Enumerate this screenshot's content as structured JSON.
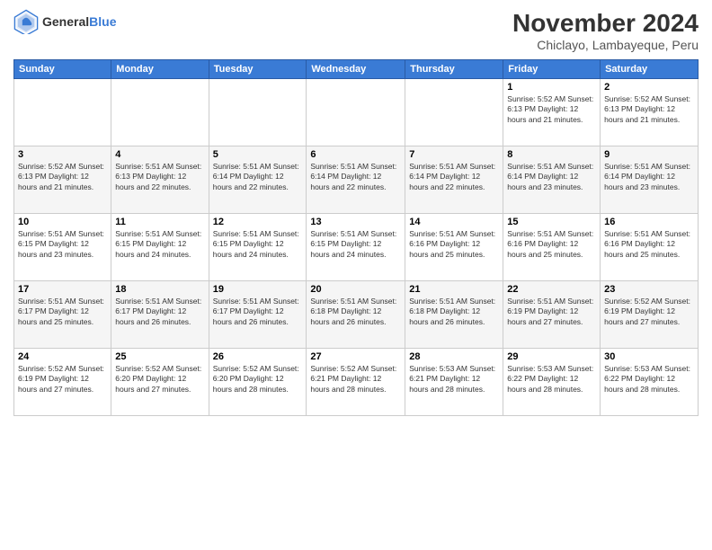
{
  "header": {
    "logo_line1": "General",
    "logo_line2": "Blue",
    "month": "November 2024",
    "location": "Chiclayo, Lambayeque, Peru"
  },
  "weekdays": [
    "Sunday",
    "Monday",
    "Tuesday",
    "Wednesday",
    "Thursday",
    "Friday",
    "Saturday"
  ],
  "weeks": [
    [
      {
        "day": "",
        "info": ""
      },
      {
        "day": "",
        "info": ""
      },
      {
        "day": "",
        "info": ""
      },
      {
        "day": "",
        "info": ""
      },
      {
        "day": "",
        "info": ""
      },
      {
        "day": "1",
        "info": "Sunrise: 5:52 AM\nSunset: 6:13 PM\nDaylight: 12 hours\nand 21 minutes."
      },
      {
        "day": "2",
        "info": "Sunrise: 5:52 AM\nSunset: 6:13 PM\nDaylight: 12 hours\nand 21 minutes."
      }
    ],
    [
      {
        "day": "3",
        "info": "Sunrise: 5:52 AM\nSunset: 6:13 PM\nDaylight: 12 hours\nand 21 minutes."
      },
      {
        "day": "4",
        "info": "Sunrise: 5:51 AM\nSunset: 6:13 PM\nDaylight: 12 hours\nand 22 minutes."
      },
      {
        "day": "5",
        "info": "Sunrise: 5:51 AM\nSunset: 6:14 PM\nDaylight: 12 hours\nand 22 minutes."
      },
      {
        "day": "6",
        "info": "Sunrise: 5:51 AM\nSunset: 6:14 PM\nDaylight: 12 hours\nand 22 minutes."
      },
      {
        "day": "7",
        "info": "Sunrise: 5:51 AM\nSunset: 6:14 PM\nDaylight: 12 hours\nand 22 minutes."
      },
      {
        "day": "8",
        "info": "Sunrise: 5:51 AM\nSunset: 6:14 PM\nDaylight: 12 hours\nand 23 minutes."
      },
      {
        "day": "9",
        "info": "Sunrise: 5:51 AM\nSunset: 6:14 PM\nDaylight: 12 hours\nand 23 minutes."
      }
    ],
    [
      {
        "day": "10",
        "info": "Sunrise: 5:51 AM\nSunset: 6:15 PM\nDaylight: 12 hours\nand 23 minutes."
      },
      {
        "day": "11",
        "info": "Sunrise: 5:51 AM\nSunset: 6:15 PM\nDaylight: 12 hours\nand 24 minutes."
      },
      {
        "day": "12",
        "info": "Sunrise: 5:51 AM\nSunset: 6:15 PM\nDaylight: 12 hours\nand 24 minutes."
      },
      {
        "day": "13",
        "info": "Sunrise: 5:51 AM\nSunset: 6:15 PM\nDaylight: 12 hours\nand 24 minutes."
      },
      {
        "day": "14",
        "info": "Sunrise: 5:51 AM\nSunset: 6:16 PM\nDaylight: 12 hours\nand 25 minutes."
      },
      {
        "day": "15",
        "info": "Sunrise: 5:51 AM\nSunset: 6:16 PM\nDaylight: 12 hours\nand 25 minutes."
      },
      {
        "day": "16",
        "info": "Sunrise: 5:51 AM\nSunset: 6:16 PM\nDaylight: 12 hours\nand 25 minutes."
      }
    ],
    [
      {
        "day": "17",
        "info": "Sunrise: 5:51 AM\nSunset: 6:17 PM\nDaylight: 12 hours\nand 25 minutes."
      },
      {
        "day": "18",
        "info": "Sunrise: 5:51 AM\nSunset: 6:17 PM\nDaylight: 12 hours\nand 26 minutes."
      },
      {
        "day": "19",
        "info": "Sunrise: 5:51 AM\nSunset: 6:17 PM\nDaylight: 12 hours\nand 26 minutes."
      },
      {
        "day": "20",
        "info": "Sunrise: 5:51 AM\nSunset: 6:18 PM\nDaylight: 12 hours\nand 26 minutes."
      },
      {
        "day": "21",
        "info": "Sunrise: 5:51 AM\nSunset: 6:18 PM\nDaylight: 12 hours\nand 26 minutes."
      },
      {
        "day": "22",
        "info": "Sunrise: 5:51 AM\nSunset: 6:19 PM\nDaylight: 12 hours\nand 27 minutes."
      },
      {
        "day": "23",
        "info": "Sunrise: 5:52 AM\nSunset: 6:19 PM\nDaylight: 12 hours\nand 27 minutes."
      }
    ],
    [
      {
        "day": "24",
        "info": "Sunrise: 5:52 AM\nSunset: 6:19 PM\nDaylight: 12 hours\nand 27 minutes."
      },
      {
        "day": "25",
        "info": "Sunrise: 5:52 AM\nSunset: 6:20 PM\nDaylight: 12 hours\nand 27 minutes."
      },
      {
        "day": "26",
        "info": "Sunrise: 5:52 AM\nSunset: 6:20 PM\nDaylight: 12 hours\nand 28 minutes."
      },
      {
        "day": "27",
        "info": "Sunrise: 5:52 AM\nSunset: 6:21 PM\nDaylight: 12 hours\nand 28 minutes."
      },
      {
        "day": "28",
        "info": "Sunrise: 5:53 AM\nSunset: 6:21 PM\nDaylight: 12 hours\nand 28 minutes."
      },
      {
        "day": "29",
        "info": "Sunrise: 5:53 AM\nSunset: 6:22 PM\nDaylight: 12 hours\nand 28 minutes."
      },
      {
        "day": "30",
        "info": "Sunrise: 5:53 AM\nSunset: 6:22 PM\nDaylight: 12 hours\nand 28 minutes."
      }
    ]
  ]
}
